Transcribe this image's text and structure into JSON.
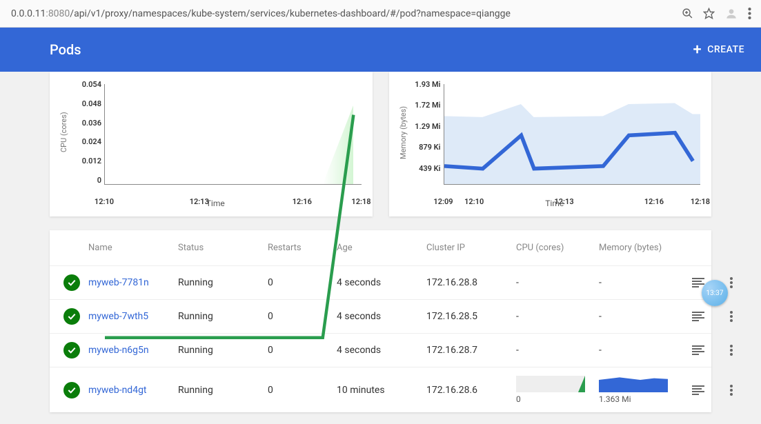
{
  "browser": {
    "url_prefix": "0.0.0.11",
    "url_port": ":8080",
    "url_path": "/api/v1/proxy/namespaces/kube-system/services/kubernetes-dashboard/#/pod?namespace=qiangge"
  },
  "header": {
    "title": "Pods",
    "create_label": "CREATE"
  },
  "chart_data": [
    {
      "type": "area",
      "title": "",
      "ylabel": "CPU (cores)",
      "xlabel": "Time",
      "y_ticks": [
        "0.054",
        "0.048",
        "0.036",
        "0.024",
        "0.012",
        "0"
      ],
      "x_ticks": [
        "12:10",
        "12:13",
        "12:16",
        "12:18"
      ],
      "series": [
        {
          "name": "cpu",
          "color": "#2a9d4e",
          "x": [
            "12:10",
            "12:13",
            "12:16",
            "12:17",
            "12:18"
          ],
          "values": [
            0,
            0,
            0,
            0,
            0.047
          ]
        }
      ],
      "ylim": [
        0,
        0.054
      ]
    },
    {
      "type": "area",
      "title": "",
      "ylabel": "Memory (bytes)",
      "xlabel": "Time",
      "y_ticks": [
        "1.93 Mi",
        "1.72 Mi",
        "1.29 Mi",
        "879 Ki",
        "439 Ki",
        ""
      ],
      "x_ticks": [
        "12:09",
        "12:10",
        "12:13",
        "12:16",
        "12:18"
      ],
      "series": [
        {
          "name": "memory",
          "color": "#3367d6",
          "x": [
            "12:09",
            "12:10",
            "12:11",
            "12:12",
            "12:13",
            "12:15",
            "12:16",
            "12:17",
            "12:18"
          ],
          "values": [
            1.31,
            1.3,
            1.61,
            1.3,
            1.31,
            1.62,
            1.68,
            1.65,
            1.36
          ]
        }
      ],
      "ylim": [
        0,
        1.93
      ]
    }
  ],
  "table": {
    "columns": [
      "Name",
      "Status",
      "Restarts",
      "Age",
      "Cluster IP",
      "CPU (cores)",
      "Memory (bytes)"
    ],
    "rows": [
      {
        "name": "myweb-7781n",
        "status": "Running",
        "restarts": "0",
        "age": "4 seconds",
        "cluster_ip": "172.16.28.8",
        "cpu": "-",
        "mem": "-",
        "has_spark": false
      },
      {
        "name": "myweb-7wth5",
        "status": "Running",
        "restarts": "0",
        "age": "4 seconds",
        "cluster_ip": "172.16.28.5",
        "cpu": "-",
        "mem": "-",
        "has_spark": false
      },
      {
        "name": "myweb-n6g5n",
        "status": "Running",
        "restarts": "0",
        "age": "4 seconds",
        "cluster_ip": "172.16.28.7",
        "cpu": "-",
        "mem": "-",
        "has_spark": false
      },
      {
        "name": "myweb-nd4gt",
        "status": "Running",
        "restarts": "0",
        "age": "10 minutes",
        "cluster_ip": "172.16.28.6",
        "cpu": "0",
        "mem": "1.363 Mi",
        "has_spark": true
      }
    ]
  },
  "clock": "13:37"
}
